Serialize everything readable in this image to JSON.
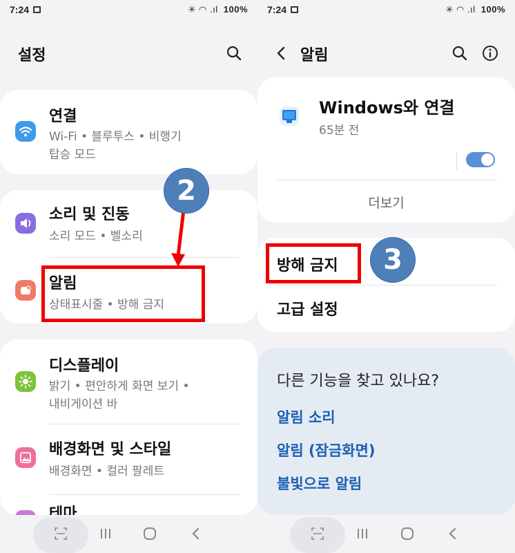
{
  "left": {
    "status": {
      "time": "7:24",
      "right": "✳ ◠ .ıl",
      "battery": "100%"
    },
    "title": "설정",
    "cards": [
      {
        "title": "연결",
        "subtitle": "Wi-Fi  •  블루투스  •  비행기",
        "subtitle2": "탑승 모드"
      },
      {
        "title": "소리 및 진동",
        "subtitle": "소리 모드  •  벨소리"
      },
      {
        "title": "알림",
        "subtitle": "상태표시줄  •  방해 금지"
      },
      {
        "title": "디스플레이",
        "subtitle": "밝기  •  편안하게 화면 보기  •",
        "subtitle2": "내비게이션 바"
      },
      {
        "title": "배경화면 및 스타일",
        "subtitle": "배경화면  •  컬러 팔레트"
      },
      {
        "title": "테마"
      }
    ],
    "badge": "2"
  },
  "right": {
    "status": {
      "time": "7:24",
      "right": "✳ ◠ .ıl",
      "battery": "100%"
    },
    "title": "알림",
    "app_card": {
      "app_name": "Windows와 연결",
      "time": "65분 전",
      "toggle_on": true,
      "more_label": "더보기"
    },
    "menu": {
      "dnd": "방해 금지",
      "advanced": "고급 설정"
    },
    "suggest": {
      "heading": "다른 기능을 찾고 있나요?",
      "links": [
        "알림 소리",
        "알림 (잠금화면)",
        "불빛으로 알림"
      ]
    },
    "badge": "3"
  },
  "colors": {
    "accent_blue": "#1a5fb4",
    "toggle_blue": "#5b8fd8",
    "badge_blue": "#4f7fb8",
    "highlight_red": "#ee0000"
  }
}
